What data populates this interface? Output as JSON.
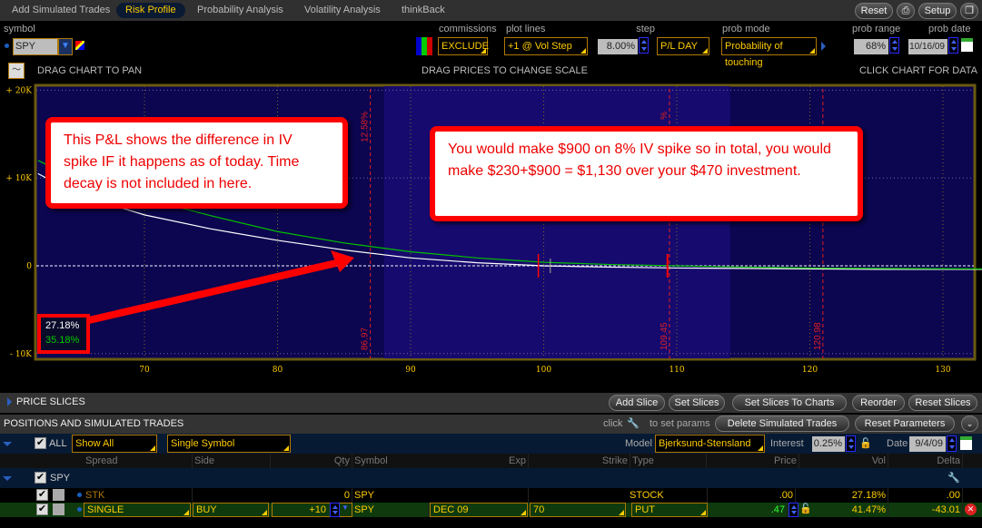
{
  "tabs": [
    {
      "label": "Add Simulated Trades"
    },
    {
      "label": "Risk Profile",
      "active": true
    },
    {
      "label": "Probability Analysis"
    },
    {
      "label": "Volatility Analysis"
    },
    {
      "label": "thinkBack"
    }
  ],
  "top_buttons": {
    "reset": "Reset",
    "setup": "Setup"
  },
  "controls": {
    "symbol_label": "symbol",
    "symbol": "SPY",
    "commissions_label": "commissions",
    "commissions": "EXCLUDE",
    "plot_lines_label": "plot lines",
    "plot_lines": "+1 @ Vol Step",
    "step_label": "step",
    "step": "8.00%",
    "pl_mode": "P/L DAY",
    "prob_mode_label": "prob mode",
    "prob_mode": "Probability of touching",
    "prob_range_label": "prob range",
    "prob_range": "68%",
    "prob_date_label": "prob date",
    "prob_date": "10/16/09"
  },
  "hints": {
    "pan": "DRAG CHART TO PAN",
    "scale": "DRAG PRICES TO CHANGE SCALE",
    "click": "CLICK CHART FOR DATA"
  },
  "colors": {
    "accent": "#ffcc00",
    "plot_bg": "#0c0550",
    "band_bg": "#170a6e",
    "line_white": "#ffffff",
    "line_green": "#00c000",
    "marker": "#ff2020"
  },
  "chart_data": {
    "type": "line",
    "xlim": [
      62,
      133
    ],
    "ylim": [
      -10000,
      20000
    ],
    "x_ticks": [
      "70",
      "80",
      "90",
      "100",
      "110",
      "120",
      "130"
    ],
    "y_ticks": [
      "+ 20K",
      "+ 10K",
      "0",
      "- 10K"
    ],
    "series": [
      {
        "name": "27.18%",
        "color": "#ffffff",
        "x": [
          62,
          65,
          70,
          75,
          80,
          85,
          90,
          95,
          100,
          105,
          110,
          115,
          120,
          125,
          133
        ],
        "y": [
          10500,
          8100,
          5800,
          4200,
          2900,
          1800,
          900,
          350,
          0,
          -150,
          -250,
          -300,
          -350,
          -400,
          -400
        ]
      },
      {
        "name": "35.18%",
        "color": "#00c000",
        "x": [
          62,
          65,
          70,
          75,
          80,
          85,
          90,
          95,
          100,
          105,
          110,
          115,
          120,
          125,
          133
        ],
        "y": [
          12000,
          9800,
          7700,
          5700,
          3900,
          2600,
          1600,
          900,
          400,
          150,
          0,
          -150,
          -250,
          -300,
          -350
        ]
      }
    ],
    "markers": [
      {
        "x": 86.97,
        "label": "86.97",
        "top_label": "12.58%"
      },
      {
        "x": 109.45,
        "label": "109.45",
        "top_label": "%"
      },
      {
        "x": 120.98,
        "label": "120.98"
      }
    ],
    "band": [
      88,
      114
    ]
  },
  "legend": {
    "white": "27.18%",
    "green": "35.18%"
  },
  "callouts": {
    "left": "This P&L shows the difference in IV spike IF it happens as of today.  Time decay is not included in here.",
    "right": "You would make $900 on 8% IV spike so in total, you would make $230+$900 = $1,130 over your $470 investment."
  },
  "price_slices": {
    "title": "PRICE SLICES",
    "buttons": [
      "Add Slice",
      "Set Slices",
      "Set Slices To Charts",
      "Reorder",
      "Reset Slices"
    ]
  },
  "positions": {
    "title": "POSITIONS AND SIMULATED TRADES",
    "click_hint": "click",
    "params_hint": "to set params",
    "delete_btn": "Delete Simulated Trades",
    "reset_btn": "Reset Parameters",
    "all_label": "ALL",
    "filter": "Show All",
    "mode": "Single Symbol",
    "model_label": "Model",
    "model": "Bjerksund-Stensland",
    "interest_label": "Interest",
    "interest": "0.25%",
    "date_label": "Date",
    "date": "9/4/09",
    "columns": {
      "spread": "Spread",
      "side": "Side",
      "qty": "Qty",
      "symbol": "Symbol",
      "exp": "Exp",
      "strike": "Strike",
      "type": "Type",
      "price": "Price",
      "vol": "Vol",
      "delta": "Delta"
    },
    "group": "SPY",
    "rows": [
      {
        "spread": "STK",
        "side": "",
        "qty": "0",
        "symbol": "SPY",
        "exp": "",
        "strike": "",
        "type": "STOCK",
        "price": ".00",
        "vol": "27.18%",
        "delta": ".00"
      },
      {
        "spread": "SINGLE",
        "side": "BUY",
        "qty": "+10",
        "symbol": "SPY",
        "exp": "DEC 09",
        "strike": "70",
        "type": "PUT",
        "price": ".47",
        "vol": "41.47%",
        "delta": "-43.01"
      }
    ]
  }
}
